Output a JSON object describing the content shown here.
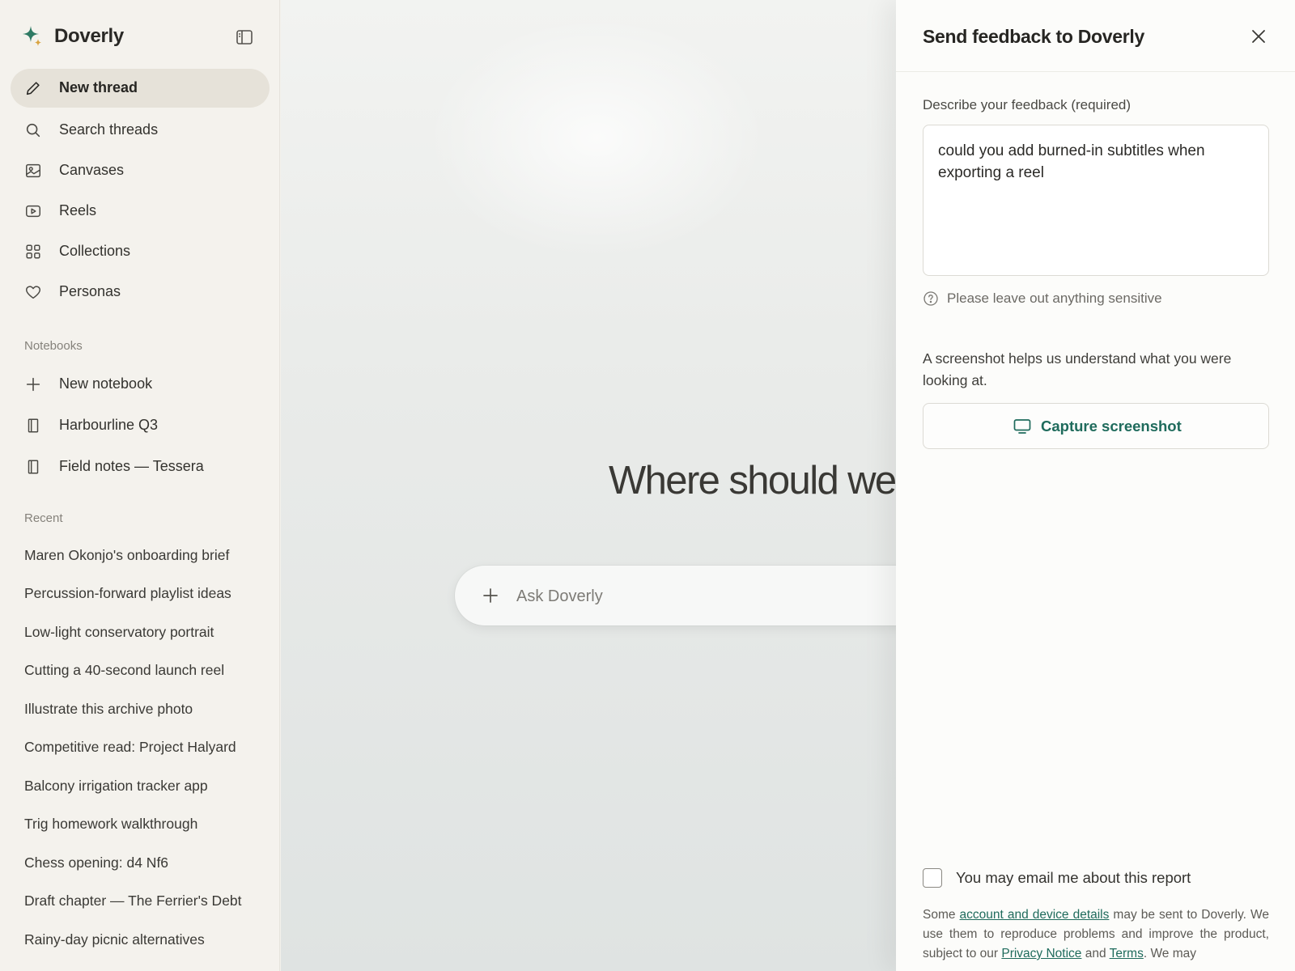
{
  "brand": {
    "name": "Doverly",
    "accent": "#1f6b5c",
    "spark_color": "#2f7a64",
    "spark_small_color": "#d9a441"
  },
  "sidebar": {
    "toggle_icon": "sidebar-toggle-icon",
    "nav": [
      {
        "label": "New thread",
        "icon": "pencil-icon",
        "active": true
      },
      {
        "label": "Search threads",
        "icon": "search-icon"
      },
      {
        "label": "Canvases",
        "icon": "image-icon"
      },
      {
        "label": "Reels",
        "icon": "play-icon"
      },
      {
        "label": "Collections",
        "icon": "grid-icon"
      },
      {
        "label": "Personas",
        "icon": "heart-icon"
      }
    ],
    "notebooks_heading": "Notebooks",
    "notebooks": [
      {
        "label": "New notebook",
        "icon": "plus-icon"
      },
      {
        "label": "Harbourline Q3",
        "icon": "notebook-icon"
      },
      {
        "label": "Field notes — Tessera",
        "icon": "notebook-icon"
      }
    ],
    "recent_heading": "Recent",
    "recent": [
      "Maren Okonjo's onboarding brief",
      "Percussion-forward playlist ideas",
      "Low-light conservatory portrait",
      "Cutting a 40-second launch reel",
      "Illustrate this archive photo",
      "Competitive read: Project Halyard",
      "Balcony irrigation tracker app",
      "Trig homework walkthrough",
      "Chess opening: d4 Nf6",
      "Draft chapter — The Ferrier's Debt",
      "Rainy-day picnic alternatives"
    ]
  },
  "main": {
    "hero": "Where should we s",
    "ask_placeholder": "Ask Doverly"
  },
  "feedback": {
    "title": "Send feedback to Doverly",
    "field_label": "Describe your feedback (required)",
    "field_value": "could you add burned-in subtitles when exporting a reel",
    "hint": "Please leave out anything sensitive",
    "screenshot_note": "A screenshot helps us understand what you were looking at.",
    "capture_label": "Capture screenshot",
    "consent_label": "You may email me about this report",
    "consent_checked": false,
    "legal": {
      "t1": "Some ",
      "link1": "account and device details",
      "t2": " may be sent to Doverly. We use them to reproduce problems and improve the product, subject to our ",
      "link2": "Privacy Notice",
      "t3": " and ",
      "link3": "Terms",
      "t4": ". We may"
    }
  }
}
